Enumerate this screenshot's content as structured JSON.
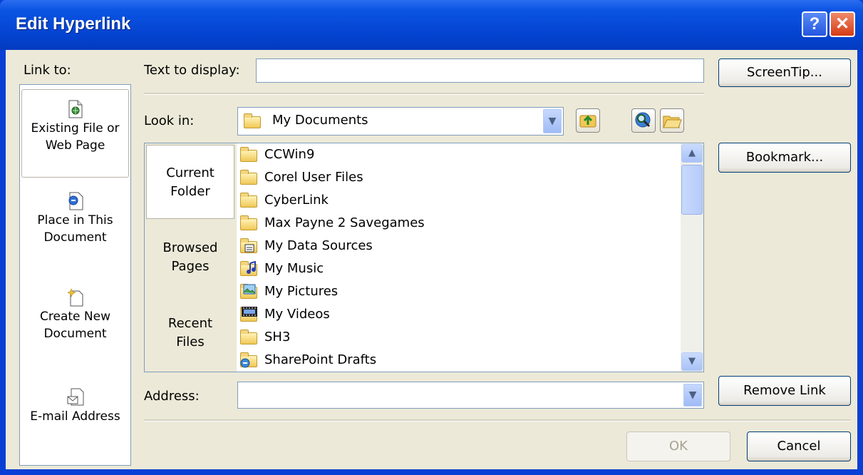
{
  "window": {
    "title": "Edit Hyperlink",
    "help_label": "?",
    "close_label": "✕"
  },
  "link_to": {
    "label": "Link to:",
    "items": [
      {
        "label": "Existing File or Web Page",
        "line1": "Existing File or",
        "line2": "Web Page",
        "icon": "existing-file-icon",
        "selected": true
      },
      {
        "label": "Place in This Document",
        "line1": "Place in This",
        "line2": "Document",
        "icon": "place-in-document-icon"
      },
      {
        "label": "Create New Document",
        "line1": "Create New",
        "line2": "Document",
        "icon": "new-document-icon"
      },
      {
        "label": "E-mail Address",
        "line1": "E-mail Address",
        "line2": "",
        "icon": "email-icon"
      }
    ]
  },
  "text_to_display": {
    "label": "Text to display:",
    "value": ""
  },
  "screentip_button": "ScreenTip...",
  "look_in": {
    "label": "Look in:",
    "value": "My Documents"
  },
  "view_tabs": [
    {
      "line1": "Current",
      "line2": "Folder",
      "selected": true
    },
    {
      "line1": "Browsed",
      "line2": "Pages"
    },
    {
      "line1": "Recent",
      "line2": "Files"
    }
  ],
  "files": [
    {
      "name": "CCWin9",
      "icon": "folder-icon"
    },
    {
      "name": "Corel User Files",
      "icon": "folder-icon"
    },
    {
      "name": "CyberLink",
      "icon": "folder-icon"
    },
    {
      "name": "Max Payne 2 Savegames",
      "icon": "folder-icon"
    },
    {
      "name": "My Data Sources",
      "icon": "data-sources-folder-icon"
    },
    {
      "name": "My Music",
      "icon": "music-folder-icon"
    },
    {
      "name": "My Pictures",
      "icon": "pictures-folder-icon"
    },
    {
      "name": "My Videos",
      "icon": "videos-folder-icon"
    },
    {
      "name": "SH3",
      "icon": "folder-icon"
    },
    {
      "name": "SharePoint Drafts",
      "icon": "sharepoint-folder-icon"
    }
  ],
  "bookmark_button": "Bookmark...",
  "address": {
    "label": "Address:",
    "value": ""
  },
  "remove_link_button": "Remove Link",
  "ok_button": "OK",
  "cancel_button": "Cancel"
}
